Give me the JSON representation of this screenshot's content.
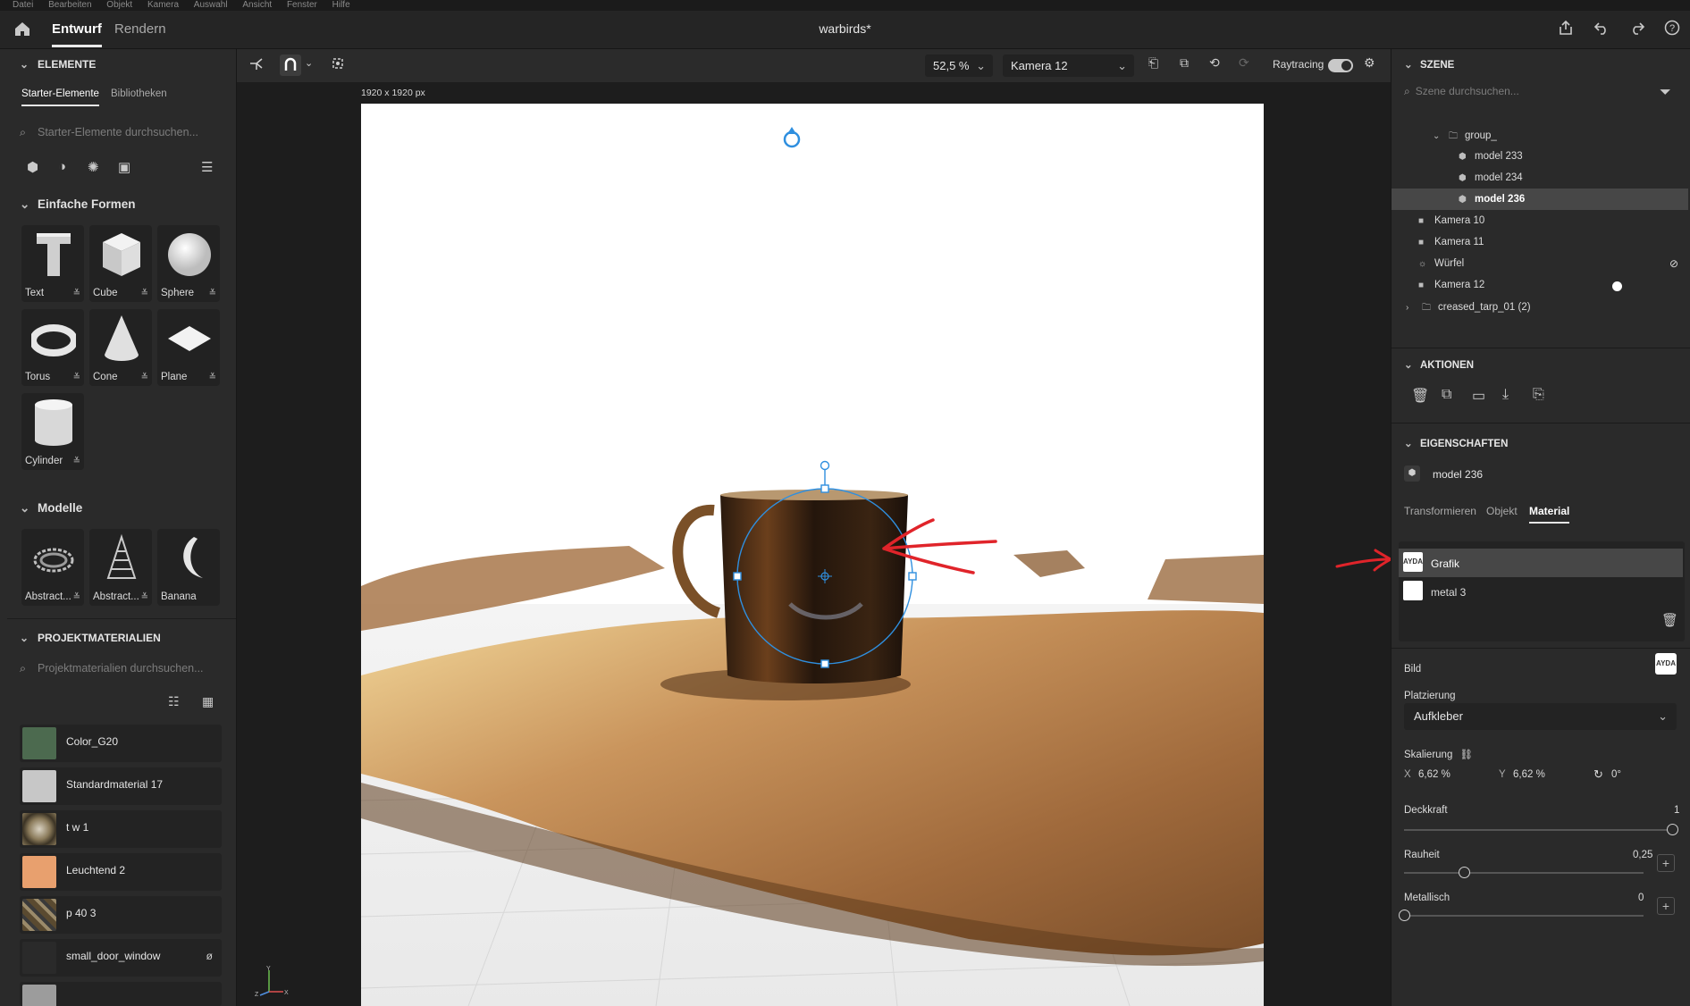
{
  "menu": {
    "items": [
      "Datei",
      "Bearbeiten",
      "Objekt",
      "Kamera",
      "Auswahl",
      "Ansicht",
      "Fenster",
      "Hilfe"
    ]
  },
  "header": {
    "tabs": [
      {
        "label": "Entwurf"
      },
      {
        "label": "Rendern"
      }
    ],
    "title": "warbirds*"
  },
  "left": {
    "elements_title": "ELEMENTE",
    "tabs": [
      "Starter-Elemente",
      "Bibliotheken"
    ],
    "search_placeholder": "Starter-Elemente durchsuchen...",
    "simple_shapes_title": "Einfache Formen",
    "shapes": [
      {
        "label": "Text"
      },
      {
        "label": "Cube"
      },
      {
        "label": "Sphere"
      },
      {
        "label": "Torus"
      },
      {
        "label": "Cone"
      },
      {
        "label": "Plane"
      },
      {
        "label": "Cylinder"
      }
    ],
    "models_title": "Modelle",
    "models": [
      {
        "label": "Abstract..."
      },
      {
        "label": "Abstract..."
      },
      {
        "label": "Banana"
      }
    ],
    "project_materials_title": "PROJEKTMATERIALIEN",
    "materials_search_placeholder": "Projektmaterialien durchsuchen...",
    "materials": [
      {
        "name": "Color_G20",
        "color": "#4c6a4f"
      },
      {
        "name": "Standardmaterial 17",
        "color": "#c7c7c7"
      },
      {
        "name": "t w 1",
        "color": "#7a6a50"
      },
      {
        "name": "Leuchtend 2",
        "color": "#e8a06e"
      },
      {
        "name": "p 40 3",
        "color": "#6b5a40"
      },
      {
        "name": "small_door_window",
        "color": "#2a2a2a"
      },
      {
        "name": "",
        "color": "#9c9c9c"
      }
    ]
  },
  "toolbar": {
    "zoom": "52,5 %",
    "camera": "Kamera 12",
    "raytracing_label": "Raytracing",
    "raytracing_on": true
  },
  "canvas": {
    "size_label": "1920 x 1920 px"
  },
  "scene": {
    "title": "SZENE",
    "search_placeholder": "Szene durchsuchen...",
    "tree": [
      {
        "label": "group_",
        "type": "folder"
      },
      {
        "label": "model 233",
        "type": "model"
      },
      {
        "label": "model 234",
        "type": "model"
      },
      {
        "label": "model 236",
        "type": "model",
        "selected": true
      },
      {
        "label": "Kamera 10",
        "type": "camera"
      },
      {
        "label": "Kamera 11",
        "type": "camera"
      },
      {
        "label": "Würfel",
        "type": "light"
      },
      {
        "label": "Kamera 12",
        "type": "camera"
      },
      {
        "label": "creased_tarp_01 (2)",
        "type": "folder"
      }
    ]
  },
  "actions": {
    "title": "AKTIONEN"
  },
  "properties": {
    "title": "EIGENSCHAFTEN",
    "object_name": "model 236",
    "tabs": [
      "Transformieren",
      "Objekt",
      "Material"
    ],
    "active_tab": "Material",
    "material_list": [
      {
        "name": "Grafik"
      },
      {
        "name": "metal 3"
      }
    ],
    "bild_label": "Bild",
    "platzierung_label": "Platzierung",
    "platzierung_value": "Aufkleber",
    "skalierung_label": "Skalierung",
    "x_label": "X",
    "x_value": "6,62 %",
    "y_label": "Y",
    "y_value": "6,62 %",
    "rotation_value": "0°",
    "deckkraft_label": "Deckkraft",
    "deckkraft_value": "1",
    "rauheit_label": "Rauheit",
    "rauheit_value": "0,25",
    "metallisch_label": "Metallisch",
    "metallisch_value": "0"
  },
  "thumb_text": "AYDA",
  "colors": {
    "accent": "#2f8fdf",
    "annotation": "#e0242a",
    "panel": "#2a2a2a"
  }
}
